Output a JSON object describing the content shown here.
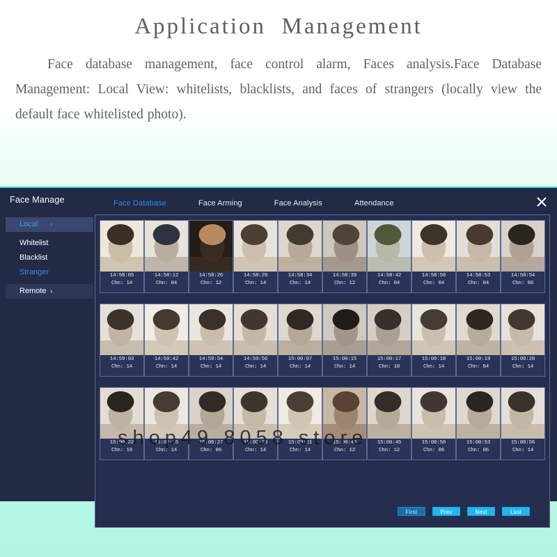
{
  "intro": {
    "title": "Application  Management",
    "body": "Face database management, face control alarm, Faces analysis.Face Database Management: Local View: whitelists, blacklists, and faces of strangers (locally view the default face whitelisted photo)."
  },
  "window": {
    "title": "Face Manage",
    "close_label": "close-icon",
    "watermark": "shop49 8058 store",
    "accent_blue": "#2f8fe8",
    "panel_bg": "#252e4e",
    "window_bg": "#222a45",
    "button_cyan": "#22b6ef",
    "top_border": "#33d6d6"
  },
  "tabs": [
    {
      "label": "Face Database",
      "active": true
    },
    {
      "label": "Face Arming",
      "active": false
    },
    {
      "label": "Face Analysis",
      "active": false
    },
    {
      "label": "Attendance",
      "active": false
    }
  ],
  "sidebar": {
    "items": [
      {
        "label": "Local",
        "chevron": "›",
        "state": "selected"
      },
      {
        "label": "Whitelist",
        "chevron": "",
        "state": "normal"
      },
      {
        "label": "Blacklist",
        "chevron": "",
        "state": "normal"
      },
      {
        "label": "Stranger",
        "chevron": "",
        "state": "link"
      },
      {
        "label": "Remote",
        "chevron": "›",
        "state": "highlight"
      }
    ]
  },
  "pagination": {
    "buttons": [
      {
        "label": "First",
        "active": true
      },
      {
        "label": "Prev",
        "active": false
      },
      {
        "label": "Next",
        "active": false
      },
      {
        "label": "Last",
        "active": false
      }
    ]
  },
  "grid": {
    "channel_prefix": "Chn:",
    "rows": [
      [
        {
          "time": "14:58:05",
          "chn": "14",
          "c1": "#efe7da",
          "c2": "#3a3026",
          "c3": "#c9bda8"
        },
        {
          "time": "14:58:12",
          "chn": "04",
          "c1": "#e8e4dc",
          "c2": "#2d3440",
          "c3": "#b9ada0"
        },
        {
          "time": "14:58:26",
          "chn": "12",
          "c1": "#241d18",
          "c2": "#b98a62",
          "c3": "#3a2c22"
        },
        {
          "time": "14:58:29",
          "chn": "14",
          "c1": "#e7e3dc",
          "c2": "#4c4036",
          "c3": "#cbbfae"
        },
        {
          "time": "14:58:34",
          "chn": "14",
          "c1": "#dcd6cc",
          "c2": "#433a31",
          "c3": "#b7a998"
        },
        {
          "time": "14:58:39",
          "chn": "12",
          "c1": "#cfc8bd",
          "c2": "#50443a",
          "c3": "#9e9184"
        },
        {
          "time": "14:58:42",
          "chn": "04",
          "c1": "#cfd6d8",
          "c2": "#4e5a3a",
          "c3": "#b6b9a8"
        },
        {
          "time": "14:58:50",
          "chn": "04",
          "c1": "#efe9e2",
          "c2": "#3d342c",
          "c3": "#cdbfae"
        },
        {
          "time": "14:58:53",
          "chn": "04",
          "c1": "#e3ded6",
          "c2": "#473b31",
          "c3": "#c5b8a7"
        },
        {
          "time": "14:58:54",
          "chn": "06",
          "c1": "#d8d2c9",
          "c2": "#2b2520",
          "c3": "#b0a295"
        }
      ],
      [
        {
          "time": "14:59:03",
          "chn": "14",
          "c1": "#e6e1d8",
          "c2": "#3c332b",
          "c3": "#c2b5a4"
        },
        {
          "time": "14:59:42",
          "chn": "14",
          "c1": "#f1ece4",
          "c2": "#443a30",
          "c3": "#cfc2b1"
        },
        {
          "time": "14:59:54",
          "chn": "14",
          "c1": "#eae5dd",
          "c2": "#3a312a",
          "c3": "#c9bcab"
        },
        {
          "time": "14:59:56",
          "chn": "14",
          "c1": "#e4ded6",
          "c2": "#413730",
          "c3": "#c4b7a6"
        },
        {
          "time": "15:00:07",
          "chn": "14",
          "c1": "#ddd7ce",
          "c2": "#2f2823",
          "c3": "#b5a897"
        },
        {
          "time": "15:00:15",
          "chn": "14",
          "c1": "#cfc9c0",
          "c2": "#221c18",
          "c3": "#a2968a"
        },
        {
          "time": "15:00:17",
          "chn": "10",
          "c1": "#d4cec5",
          "c2": "#38302a",
          "c3": "#ab9f93"
        },
        {
          "time": "15:00:18",
          "chn": "14",
          "c1": "#e9e4dc",
          "c2": "#463c32",
          "c3": "#cbbeac"
        },
        {
          "time": "15:00:19",
          "chn": "04",
          "c1": "#dfd9d0",
          "c2": "#2e2722",
          "c3": "#b8ab9a"
        },
        {
          "time": "15:00:20",
          "chn": "14",
          "c1": "#e7e1d9",
          "c2": "#433930",
          "c3": "#c7baa9"
        }
      ],
      [
        {
          "time": "15:00:22",
          "chn": "10",
          "c1": "#e2ddd4",
          "c2": "#2b2520",
          "c3": "#bfb2a2"
        },
        {
          "time": "15:00:25",
          "chn": "14",
          "c1": "#ece7df",
          "c2": "#463c33",
          "c3": "#cec1b0"
        },
        {
          "time": "15:00:27",
          "chn": "06",
          "c1": "#d9d3ca",
          "c2": "#332c26",
          "c3": "#b3a695"
        },
        {
          "time": "15:00:28",
          "chn": "14",
          "c1": "#e5e0d7",
          "c2": "#3e352d",
          "c3": "#c6b9a8"
        },
        {
          "time": "15:00:31",
          "chn": "14",
          "c1": "#efeae2",
          "c2": "#4a3f35",
          "c3": "#d1c4b3"
        },
        {
          "time": "15:00:44",
          "chn": "12",
          "c1": "#c9b7a6",
          "c2": "#5a4334",
          "c3": "#9d8670"
        },
        {
          "time": "15:00:45",
          "chn": "12",
          "c1": "#dcd6cd",
          "c2": "#352d27",
          "c3": "#b6a998"
        },
        {
          "time": "15:00:50",
          "chn": "06",
          "c1": "#e8e3db",
          "c2": "#413730",
          "c3": "#c9bcab"
        },
        {
          "time": "15:00:53",
          "chn": "06",
          "c1": "#ded8cf",
          "c2": "#2c2621",
          "c3": "#b7aa99"
        },
        {
          "time": "15:00:56",
          "chn": "14",
          "c1": "#e4dfd6",
          "c2": "#3b322b",
          "c3": "#c3b6a5"
        }
      ]
    ]
  }
}
